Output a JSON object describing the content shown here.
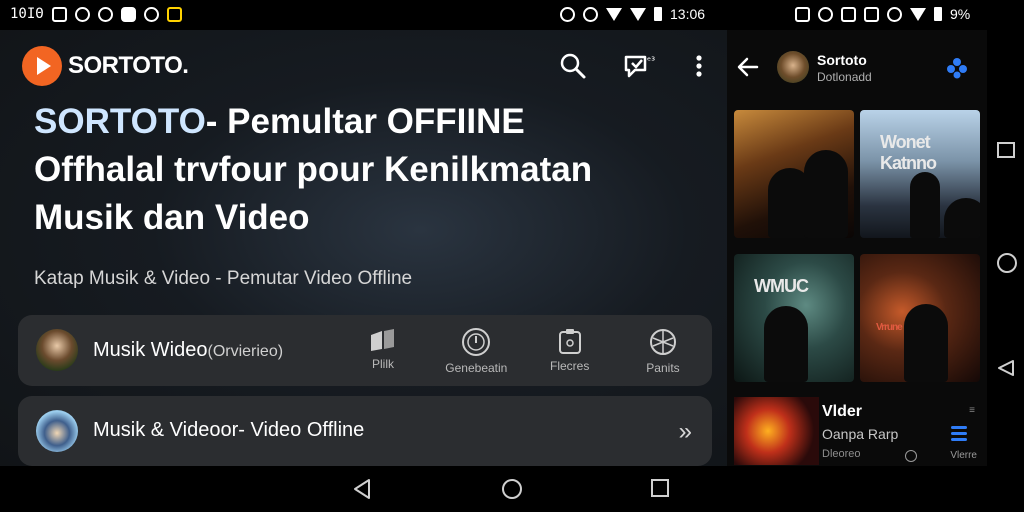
{
  "status": {
    "left_text": "10IΘ",
    "time": "13:06",
    "battery_pct": "9%"
  },
  "app": {
    "brand": "SORTOTO."
  },
  "hero": {
    "title_accent": "SORTOTO",
    "title_rest": "- Pemultar OFFIINE",
    "line2": "Offhalal trvfour pour Kenilkmatan",
    "line3": "Musik dan Video",
    "subtitle": "Katap Musik & Video - Pemutar Video Offline"
  },
  "card1": {
    "title": "Musik Wideo",
    "paren": "(Orvierieo)",
    "actions": [
      {
        "label": "Plilk",
        "icon": "folder-icon"
      },
      {
        "label": "Genebeatin",
        "icon": "clock-icon"
      },
      {
        "label": "Flecres",
        "icon": "file-icon"
      },
      {
        "label": "Panits",
        "icon": "globe-icon"
      }
    ]
  },
  "card2": {
    "title": "Musik & Videoor- Video Offline",
    "chevron": "»"
  },
  "right_panel": {
    "title": "Sortoto",
    "subtitle": "Dotlonadd",
    "thumbs": [
      {
        "text": ""
      },
      {
        "text": "Wonet Katnno"
      },
      {
        "text": "WMUC"
      },
      {
        "text": "Vrrune"
      }
    ],
    "row": {
      "title": "Vlder",
      "subtitle": "Oanpa Rarp",
      "meta": "Dleoreo",
      "menu": "≡",
      "stack_label": "Vlerre"
    }
  },
  "colors": {
    "brand_orange": "#f26522",
    "accent_blue": "#2f7cf6",
    "card_bg": "#2b2d30"
  }
}
